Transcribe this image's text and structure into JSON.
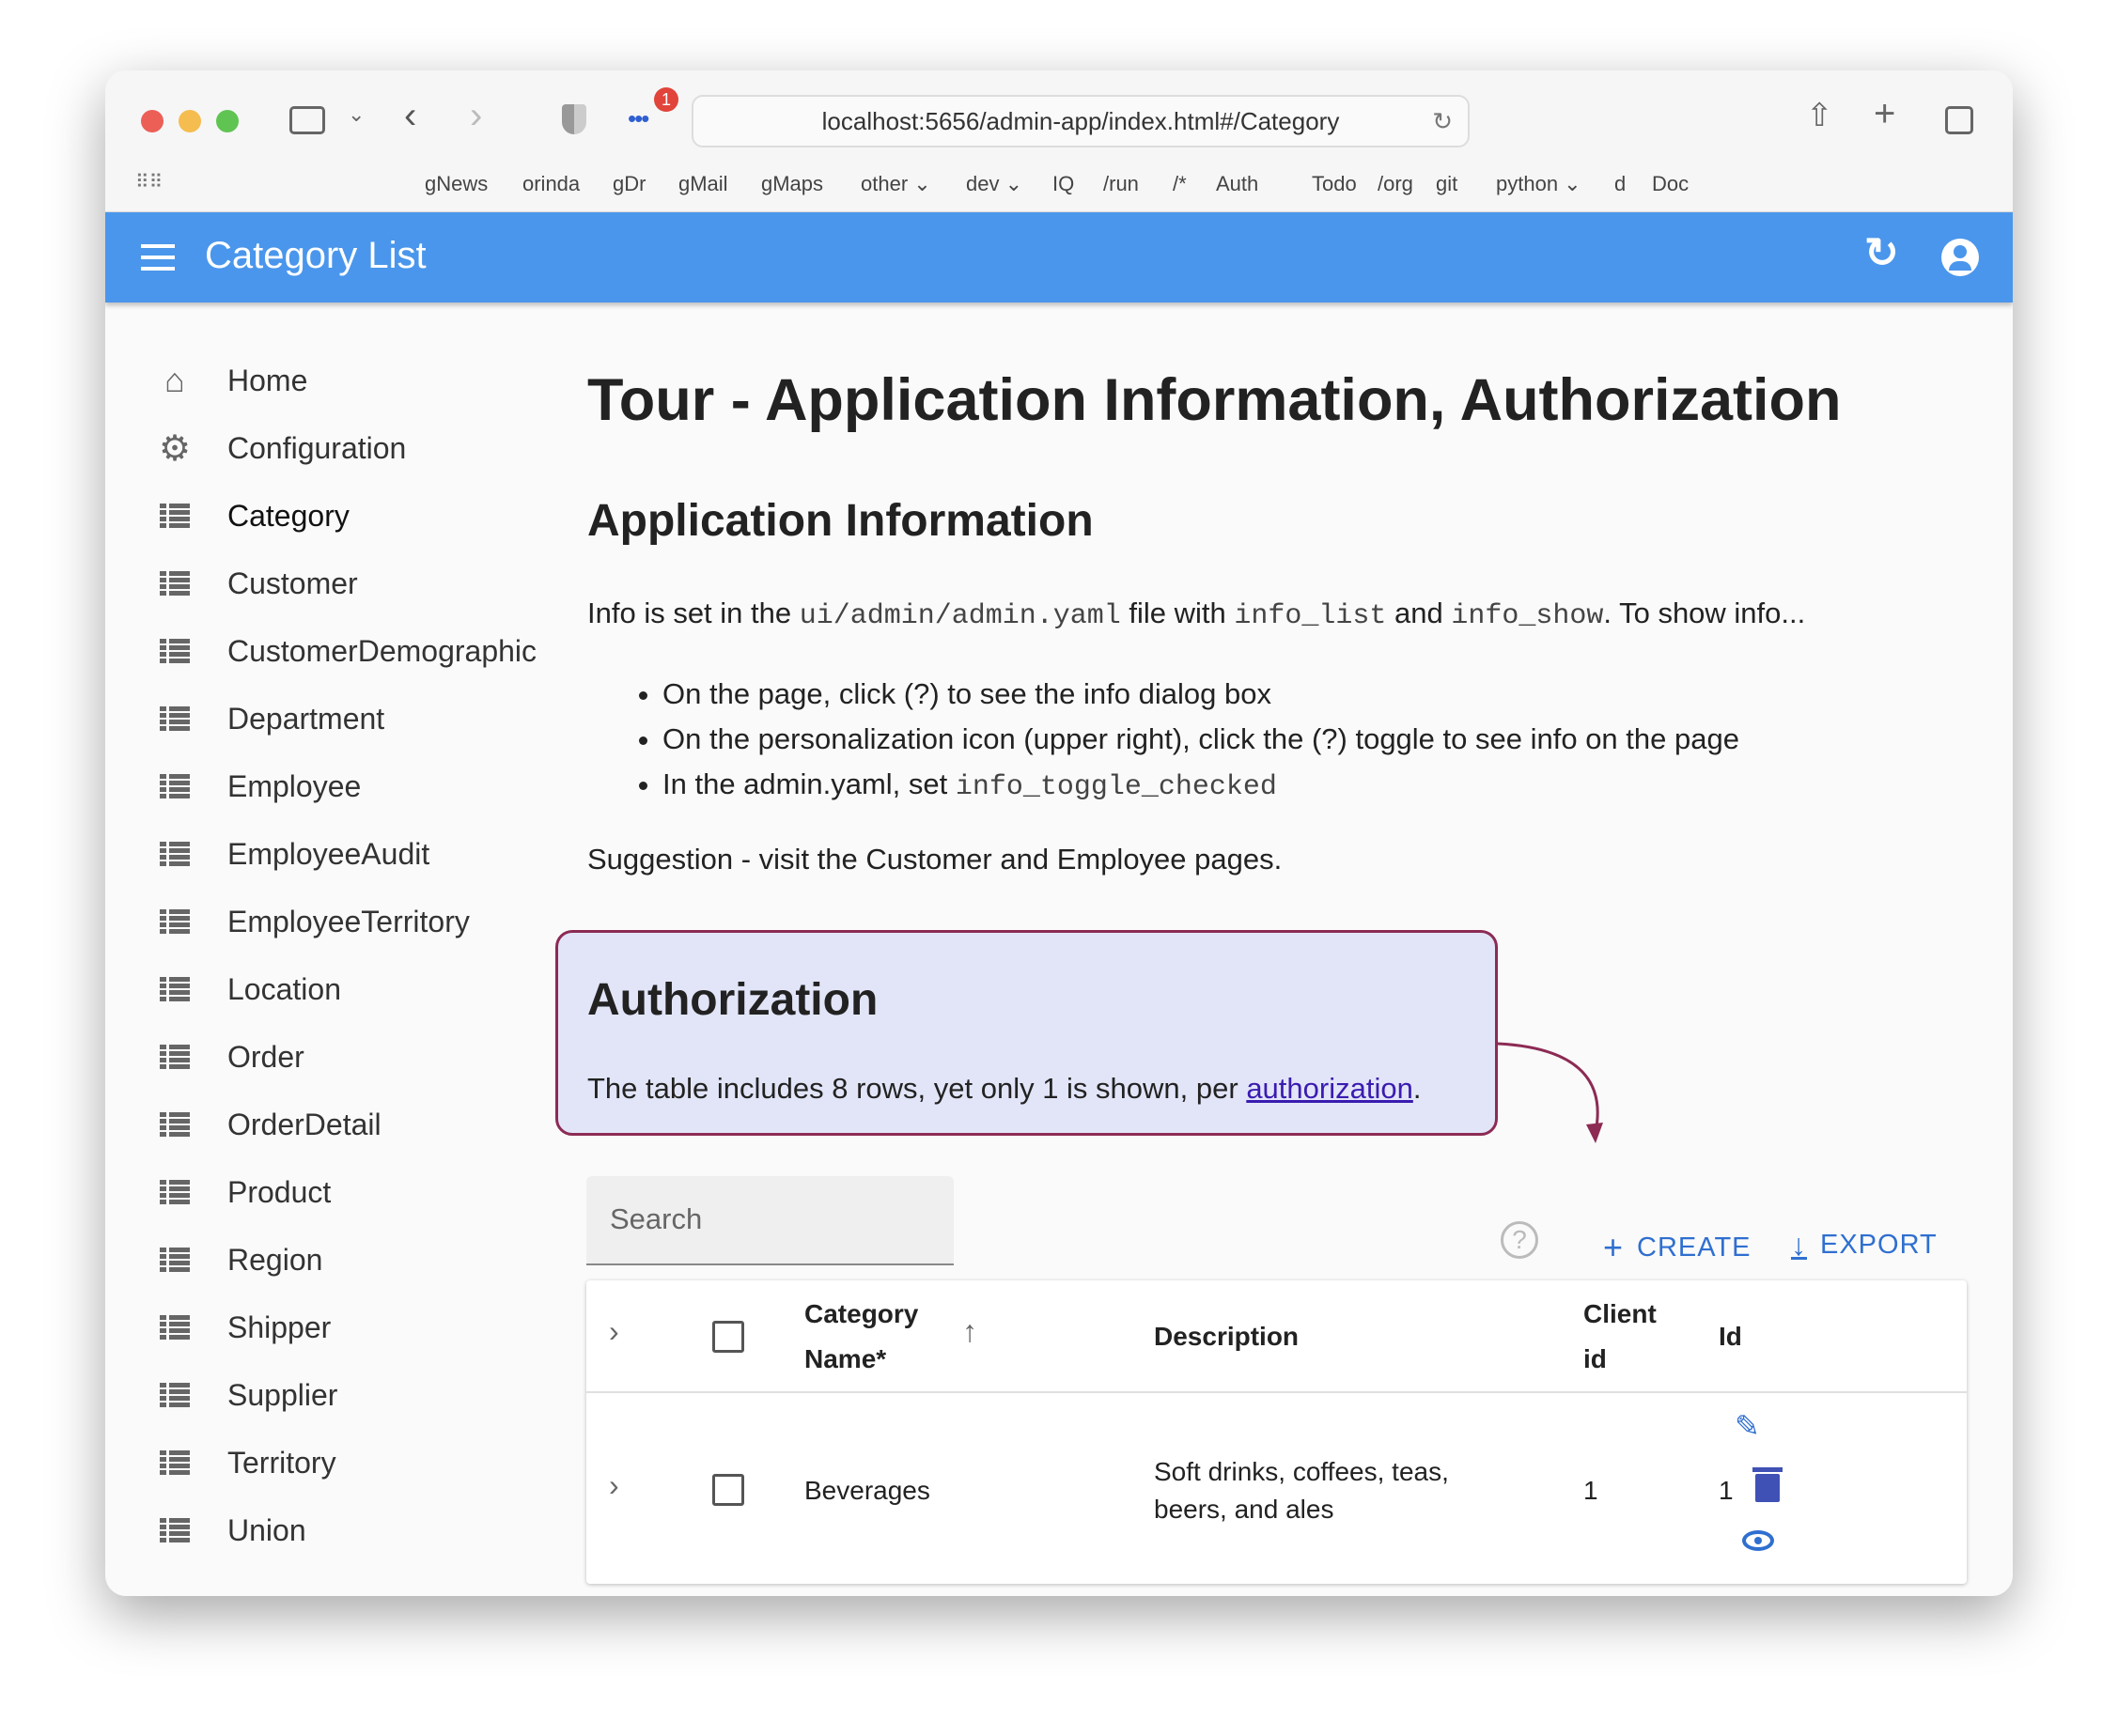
{
  "browser": {
    "url": "localhost:5656/admin-app/index.html#/Category",
    "badge": "1",
    "bookmarks": [
      "gNews",
      "orinda",
      "gDr",
      "gMail",
      "gMaps",
      "other ⌄",
      "dev ⌄",
      "IQ",
      "/run",
      "/*",
      "Auth",
      "Todo",
      "/org",
      "git",
      "python ⌄",
      "d",
      "Doc"
    ]
  },
  "appbar": {
    "title": "Category List"
  },
  "sidebar": {
    "items": [
      {
        "label": "Home",
        "icon": "home-icon"
      },
      {
        "label": "Configuration",
        "icon": "gear-icon"
      },
      {
        "label": "Category",
        "icon": "list-icon"
      },
      {
        "label": "Customer",
        "icon": "list-icon"
      },
      {
        "label": "CustomerDemographic",
        "icon": "list-icon"
      },
      {
        "label": "Department",
        "icon": "list-icon"
      },
      {
        "label": "Employee",
        "icon": "list-icon"
      },
      {
        "label": "EmployeeAudit",
        "icon": "list-icon"
      },
      {
        "label": "EmployeeTerritory",
        "icon": "list-icon"
      },
      {
        "label": "Location",
        "icon": "list-icon"
      },
      {
        "label": "Order",
        "icon": "list-icon"
      },
      {
        "label": "OrderDetail",
        "icon": "list-icon"
      },
      {
        "label": "Product",
        "icon": "list-icon"
      },
      {
        "label": "Region",
        "icon": "list-icon"
      },
      {
        "label": "Shipper",
        "icon": "list-icon"
      },
      {
        "label": "Supplier",
        "icon": "list-icon"
      },
      {
        "label": "Territory",
        "icon": "list-icon"
      },
      {
        "label": "Union",
        "icon": "list-icon"
      }
    ]
  },
  "main": {
    "title": "Tour - Application Information, Authorization",
    "app_info_heading": "Application Information",
    "info_p": {
      "t1": "Info is set in the ",
      "c1": "ui/admin/admin.yaml",
      "t2": " file with ",
      "c2": "info_list",
      "t3": " and ",
      "c3": "info_show",
      "t4": ". To show info..."
    },
    "bullets": [
      "On the page, click (?) to see the info dialog box",
      "On the personalization icon (upper right), click the (?) toggle to see info on the page",
      "In the admin.yaml, set "
    ],
    "bullet3_code": "info_toggle_checked",
    "suggestion": "Suggestion - visit the Customer and Employee pages.",
    "auth": {
      "heading": "Authorization",
      "text": "The table includes 8 rows, yet only 1 is shown, per ",
      "link": "authorization",
      "end": "."
    },
    "search_placeholder": "Search",
    "create_label": "CREATE",
    "export_label": "EXPORT",
    "table": {
      "headers": {
        "name1": "Category",
        "name2": "Name*",
        "description": "Description",
        "client1": "Client",
        "client2": "id",
        "id": "Id"
      },
      "rows": [
        {
          "name": "Beverages",
          "desc1": "Soft drinks, coffees, teas,",
          "desc2": "beers, and ales",
          "client_id": "1",
          "id": "1"
        }
      ]
    }
  },
  "colors": {
    "appbar": "#4a96ec",
    "accent": "#2f6fd0",
    "auth_border": "#8c2b54",
    "auth_bg": "#e2e5f8"
  }
}
